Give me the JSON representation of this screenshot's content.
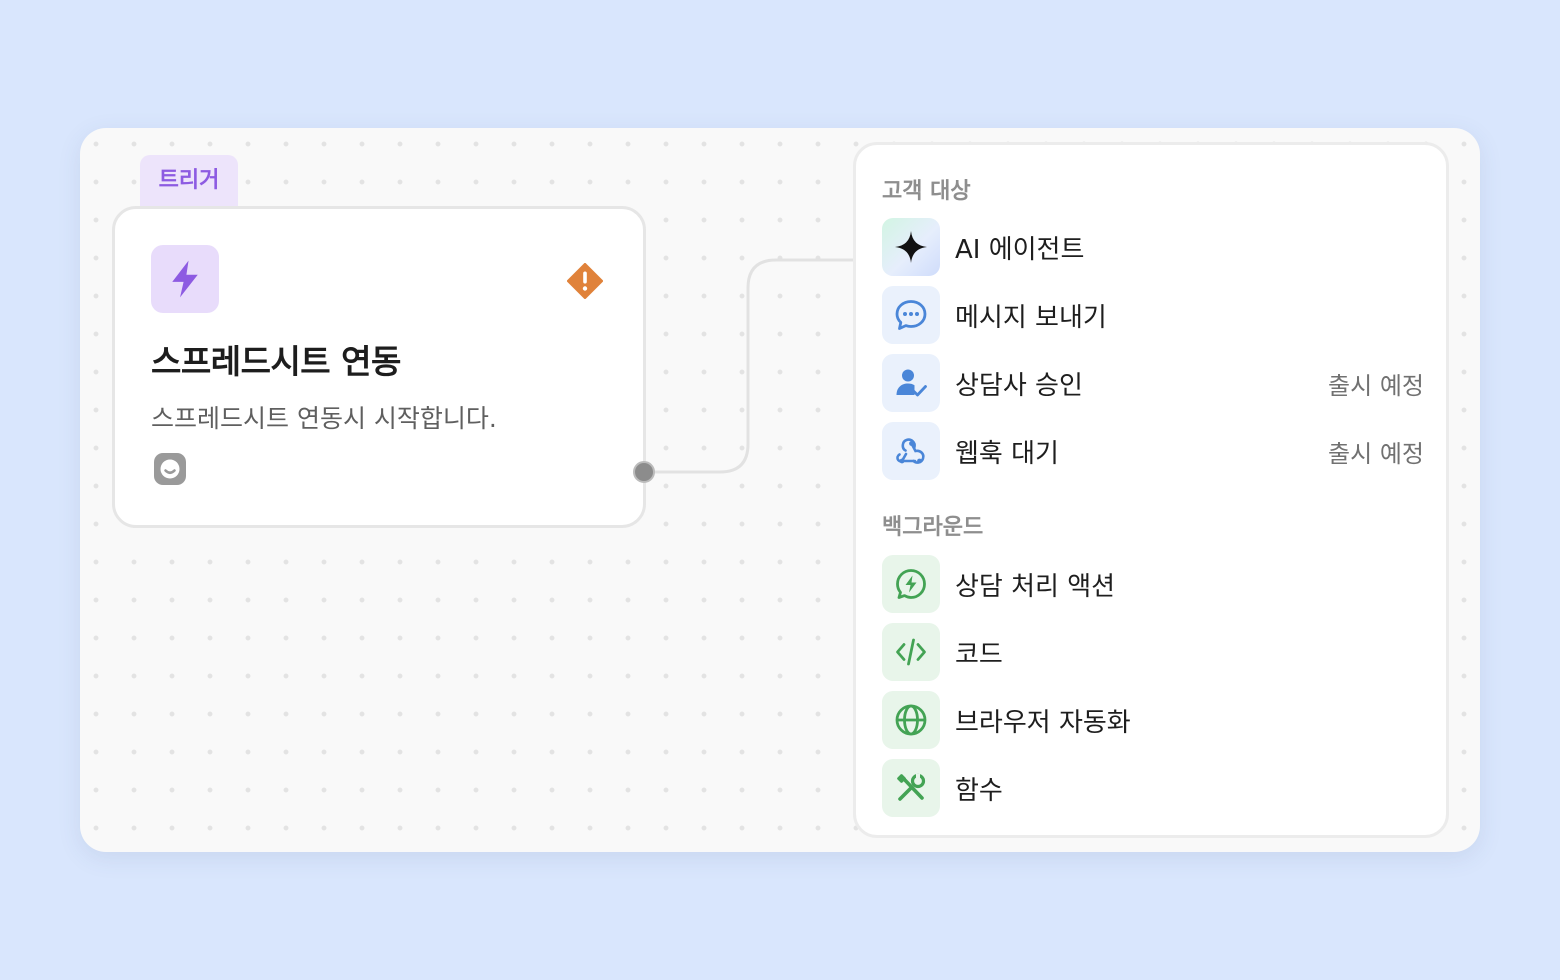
{
  "trigger": {
    "tab_label": "트리거",
    "title": "스프레드시트 연동",
    "description": "스프레드시트 연동시 시작합니다."
  },
  "menu": {
    "sections": [
      {
        "label": "고객 대상",
        "items": [
          {
            "label": "AI 에이전트",
            "icon": "sparkle-icon",
            "badge": ""
          },
          {
            "label": "메시지 보내기",
            "icon": "chat-bubble-icon",
            "badge": ""
          },
          {
            "label": "상담사 승인",
            "icon": "user-check-icon",
            "badge": "출시 예정"
          },
          {
            "label": "웹훅 대기",
            "icon": "webhook-icon",
            "badge": "출시 예정"
          }
        ]
      },
      {
        "label": "백그라운드",
        "items": [
          {
            "label": "상담 처리 액션",
            "icon": "bolt-chat-icon",
            "badge": ""
          },
          {
            "label": "코드",
            "icon": "code-icon",
            "badge": ""
          },
          {
            "label": "브라우저 자동화",
            "icon": "globe-icon",
            "badge": ""
          },
          {
            "label": "함수",
            "icon": "tools-icon",
            "badge": ""
          }
        ]
      }
    ]
  },
  "colors": {
    "background": "#d9e6fd",
    "trigger_accent": "#8d5be2",
    "warning": "#e0823a",
    "blue_icon": "#4a86d8",
    "green_icon": "#43a354"
  }
}
